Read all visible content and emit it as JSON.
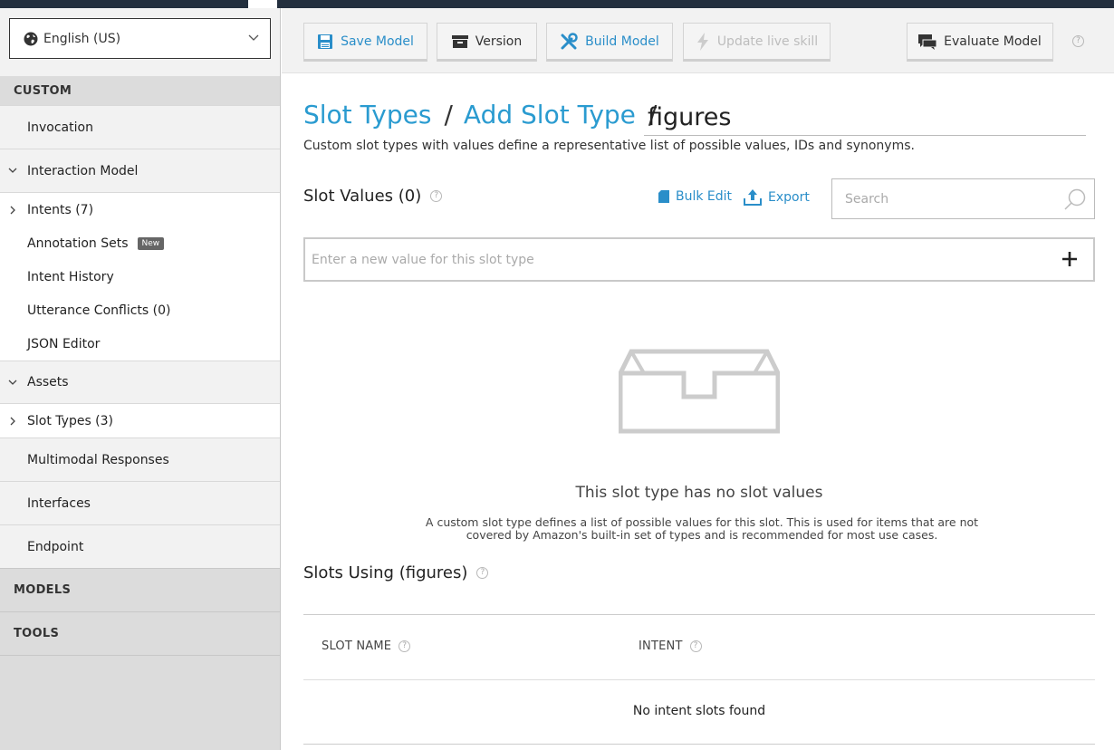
{
  "locale": {
    "selected": "English (US)"
  },
  "sidebar": {
    "custom_header": "CUSTOM",
    "invocation": "Invocation",
    "interaction_model": "Interaction Model",
    "intents": "Intents (7)",
    "annotation_sets": "Annotation Sets",
    "annotation_badge": "New",
    "intent_history": "Intent History",
    "utterance_conflicts": "Utterance Conflicts (0)",
    "json_editor": "JSON Editor",
    "assets": "Assets",
    "slot_types": "Slot Types (3)",
    "multimodal": "Multimodal Responses",
    "interfaces": "Interfaces",
    "endpoint": "Endpoint",
    "models_header": "MODELS",
    "tools_header": "TOOLS"
  },
  "toolbar": {
    "save": "Save Model",
    "version": "Version",
    "build": "Build Model",
    "update": "Update live skill",
    "evaluate": "Evaluate Model",
    "help": "?"
  },
  "breadcrumb": {
    "slot_types": "Slot Types",
    "sep1": "/",
    "add_slot_type": "Add Slot Type",
    "sep2": "/",
    "name_value": "figures"
  },
  "subtitle": "Custom slot types with values define a representative list of possible values, IDs and synonyms.",
  "slot_values": {
    "title": "Slot Values (0)",
    "bulk_edit": "Bulk Edit",
    "export": "Export",
    "search_placeholder": "Search",
    "new_value_placeholder": "Enter a new value for this slot type"
  },
  "empty_state": {
    "title": "This slot type has no slot values",
    "description": "A custom slot type defines a list of possible values for this slot. This is used for items that are not covered by Amazon's built-in set of types and is recommended for most use cases."
  },
  "slots_using": {
    "title": "Slots Using (figures)",
    "col_slot_name": "SLOT NAME",
    "col_intent": "INTENT",
    "empty": "No intent slots found"
  },
  "colors": {
    "accent": "#2a9bd0",
    "topbar": "#232f3e"
  }
}
